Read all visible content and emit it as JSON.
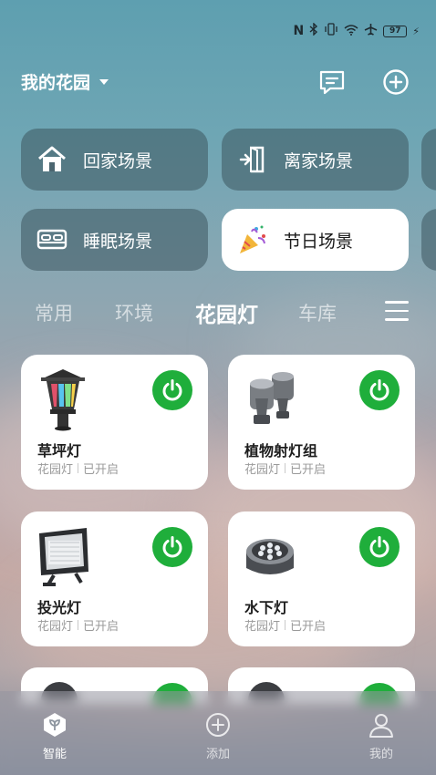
{
  "status_bar": {
    "icons": [
      "nfc-icon",
      "bluetooth-icon",
      "vibrate-icon",
      "wifi-icon",
      "airplane-icon"
    ],
    "battery": "97"
  },
  "header": {
    "home_name": "我的花园",
    "message_icon": "message-icon",
    "add_icon": "add-circle-icon"
  },
  "scenes": [
    {
      "label": "回家场景",
      "icon": "home-icon"
    },
    {
      "label": "离家场景",
      "icon": "leave-door-icon"
    },
    {
      "label": "睡眠场景",
      "icon": "bed-icon"
    },
    {
      "label": "节日场景",
      "icon": "party-popper-icon"
    }
  ],
  "tabs": [
    {
      "label": "常用"
    },
    {
      "label": "环境"
    },
    {
      "label": "花园灯"
    },
    {
      "label": "车库"
    }
  ],
  "active_tab": "花园灯",
  "devices": [
    {
      "name": "草坪灯",
      "room": "花园灯",
      "status": "已开启",
      "icon": "lawn-lamp-icon"
    },
    {
      "name": "植物射灯组",
      "room": "花园灯",
      "status": "已开启",
      "icon": "spotlight-group-icon"
    },
    {
      "name": "投光灯",
      "room": "花园灯",
      "status": "已开启",
      "icon": "floodlight-icon"
    },
    {
      "name": "水下灯",
      "room": "花园灯",
      "status": "已开启",
      "icon": "underwater-light-icon"
    }
  ],
  "bottom_nav": [
    {
      "label": "智能",
      "icon": "smart-icon"
    },
    {
      "label": "添加",
      "icon": "add-icon"
    },
    {
      "label": "我的",
      "icon": "profile-icon"
    }
  ],
  "colors": {
    "power_on": "#1fae3b",
    "card_bg": "#ffffff",
    "scene_bg": "#3c555f"
  }
}
